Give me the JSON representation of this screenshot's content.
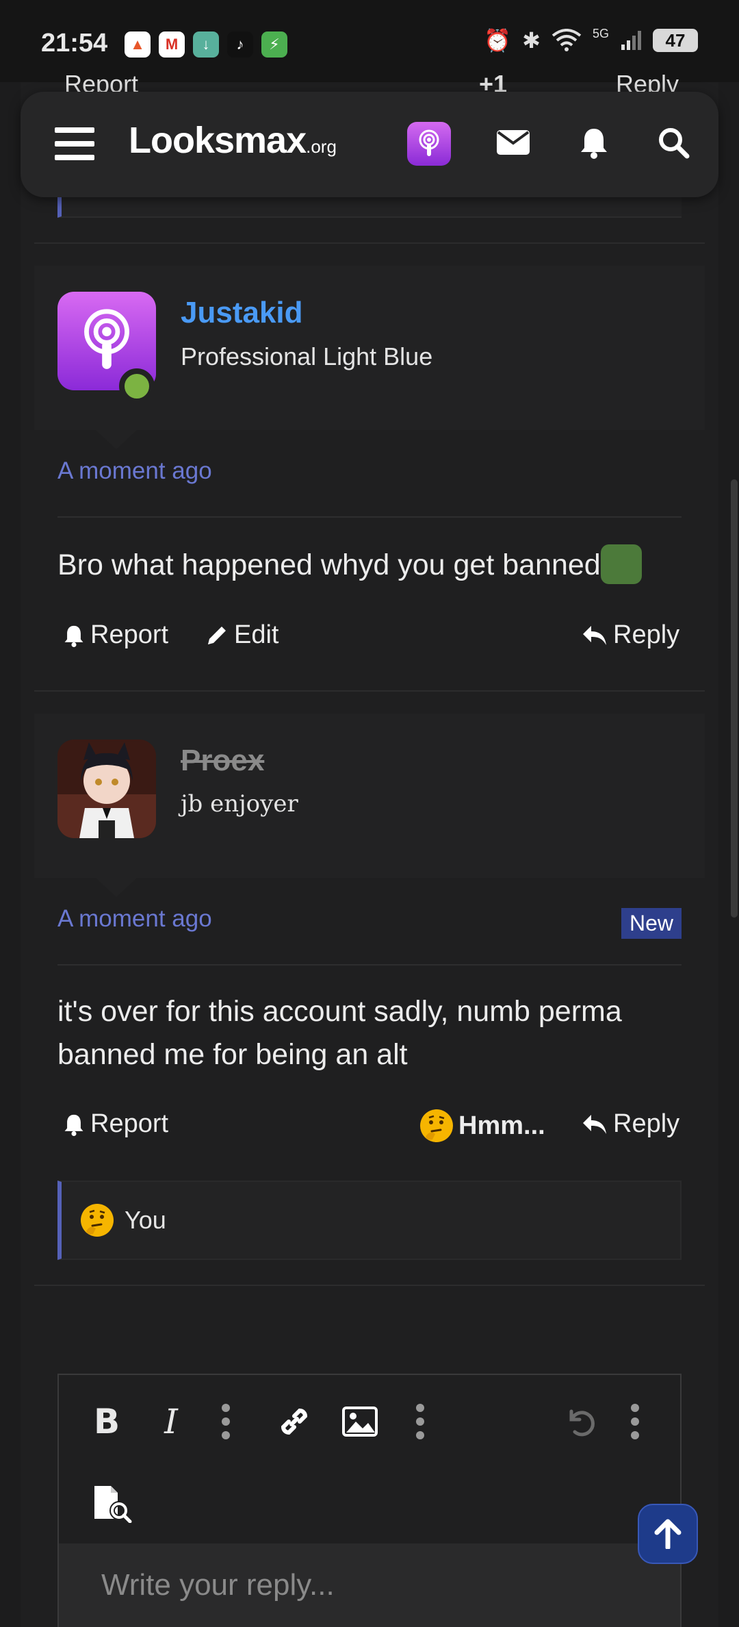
{
  "status_bar": {
    "time": "21:54",
    "battery": "47",
    "network": "5G"
  },
  "nav": {
    "logo_main": "Looksmax",
    "logo_suffix": ".org"
  },
  "peek": {
    "report": "Report",
    "reactions": "+1",
    "reply": "Reply"
  },
  "posts": [
    {
      "username": "Justakid",
      "user_title": "Professional Light Blue",
      "timestamp": "A moment ago",
      "body": "Bro what happened whyd you get banned",
      "actions": {
        "report": "Report",
        "edit": "Edit",
        "reply": "Reply"
      }
    },
    {
      "username": "Proex",
      "user_title": "jb enjoyer",
      "timestamp": "A moment ago",
      "badge": "New",
      "body": "it's over for this account sadly, numb perma banned me for being an alt",
      "actions": {
        "report": "Report",
        "reaction": "Hmm...",
        "reply": "Reply"
      },
      "reaction_summary": "You"
    }
  ],
  "editor": {
    "placeholder": "Write your reply..."
  },
  "colors": {
    "accent_blue": "#4a9af5",
    "timestamp_purple": "#6a78d1",
    "quote_border": "#5561b8",
    "new_badge_bg": "#2e3f8c",
    "online_green": "#7cb342"
  }
}
